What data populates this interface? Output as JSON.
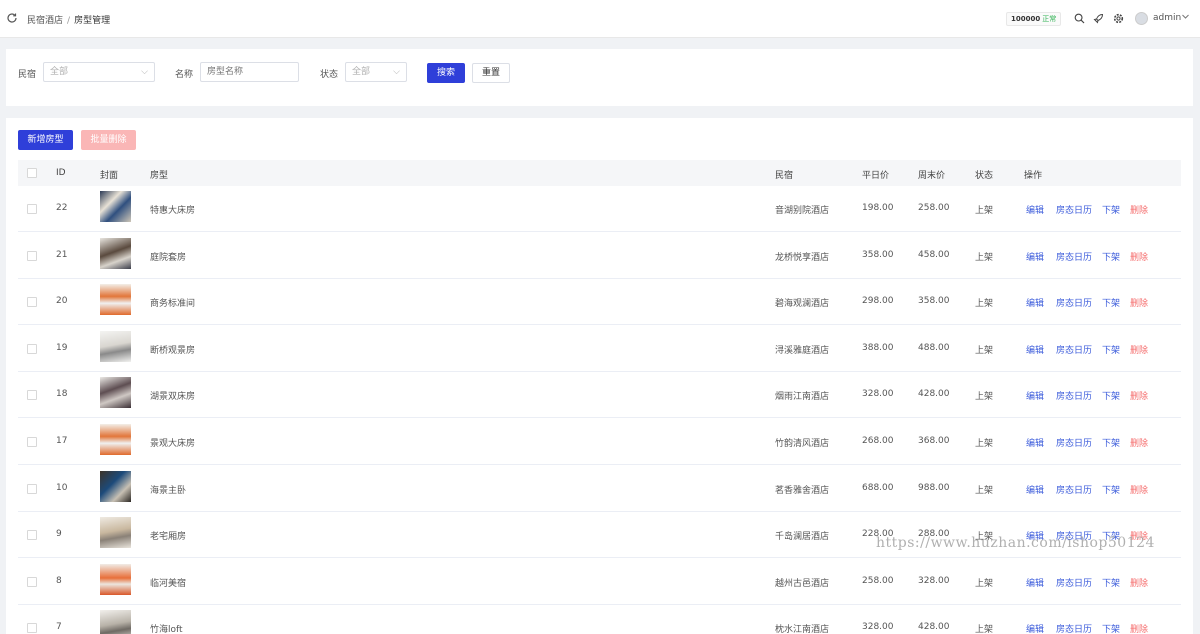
{
  "breadcrumb": {
    "home": "民宿酒店",
    "sep": "/",
    "current": "房型管理"
  },
  "header": {
    "quota_number": "100000",
    "quota_status": "正常",
    "username": "admin",
    "icons": [
      "refresh-icon",
      "search-icon",
      "rocket-icon",
      "gear-icon",
      "avatar",
      "chevron-down-icon"
    ]
  },
  "filter": {
    "homestay_label": "民宿",
    "homestay_value": "全部",
    "name_label": "名称",
    "name_placeholder": "房型名称",
    "status_label": "状态",
    "status_value": "全部",
    "search_label": "搜索",
    "reset_label": "重置"
  },
  "toolbar": {
    "add_label": "新增房型",
    "batch_delete_label": "批量删除"
  },
  "table": {
    "headers": [
      "ID",
      "封面",
      "房型",
      "民宿",
      "平日价",
      "周末价",
      "状态",
      "操作"
    ],
    "actions": {
      "edit": "编辑",
      "calendar": "房态日历",
      "offshelf": "下架",
      "delete": "删除"
    },
    "rows": [
      {
        "id": "22",
        "name": "特惠大床房",
        "homestay": "音湖别院酒店",
        "weekday": "198.00",
        "weekend": "258.00",
        "status": "上架"
      },
      {
        "id": "21",
        "name": "庭院套房",
        "homestay": "龙桥悦享酒店",
        "weekday": "358.00",
        "weekend": "458.00",
        "status": "上架"
      },
      {
        "id": "20",
        "name": "商务标准间",
        "homestay": "碧海观澜酒店",
        "weekday": "298.00",
        "weekend": "358.00",
        "status": "上架"
      },
      {
        "id": "19",
        "name": "断桥观景房",
        "homestay": "浔溪雅庭酒店",
        "weekday": "388.00",
        "weekend": "488.00",
        "status": "上架"
      },
      {
        "id": "18",
        "name": "湖景双床房",
        "homestay": "烟雨江南酒店",
        "weekday": "328.00",
        "weekend": "428.00",
        "status": "上架"
      },
      {
        "id": "17",
        "name": "景观大床房",
        "homestay": "竹韵清风酒店",
        "weekday": "268.00",
        "weekend": "368.00",
        "status": "上架"
      },
      {
        "id": "10",
        "name": "海景主卧",
        "homestay": "茗香雅舍酒店",
        "weekday": "688.00",
        "weekend": "988.00",
        "status": "上架"
      },
      {
        "id": "9",
        "name": "老宅厢房",
        "homestay": "千岛澜居酒店",
        "weekday": "228.00",
        "weekend": "288.00",
        "status": "上架"
      },
      {
        "id": "8",
        "name": "临河美宿",
        "homestay": "越州古邑酒店",
        "weekday": "258.00",
        "weekend": "328.00",
        "status": "上架"
      },
      {
        "id": "7",
        "name": "竹海loft",
        "homestay": "枕水江南酒店",
        "weekday": "328.00",
        "weekend": "428.00",
        "status": "上架"
      }
    ]
  },
  "watermark": "https://www.huzhan.com/ishop50124",
  "colors": {
    "primary": "#2f3fd9",
    "link": "#3b5bdb",
    "danger": "#f56c6c",
    "success": "#2fb152"
  }
}
